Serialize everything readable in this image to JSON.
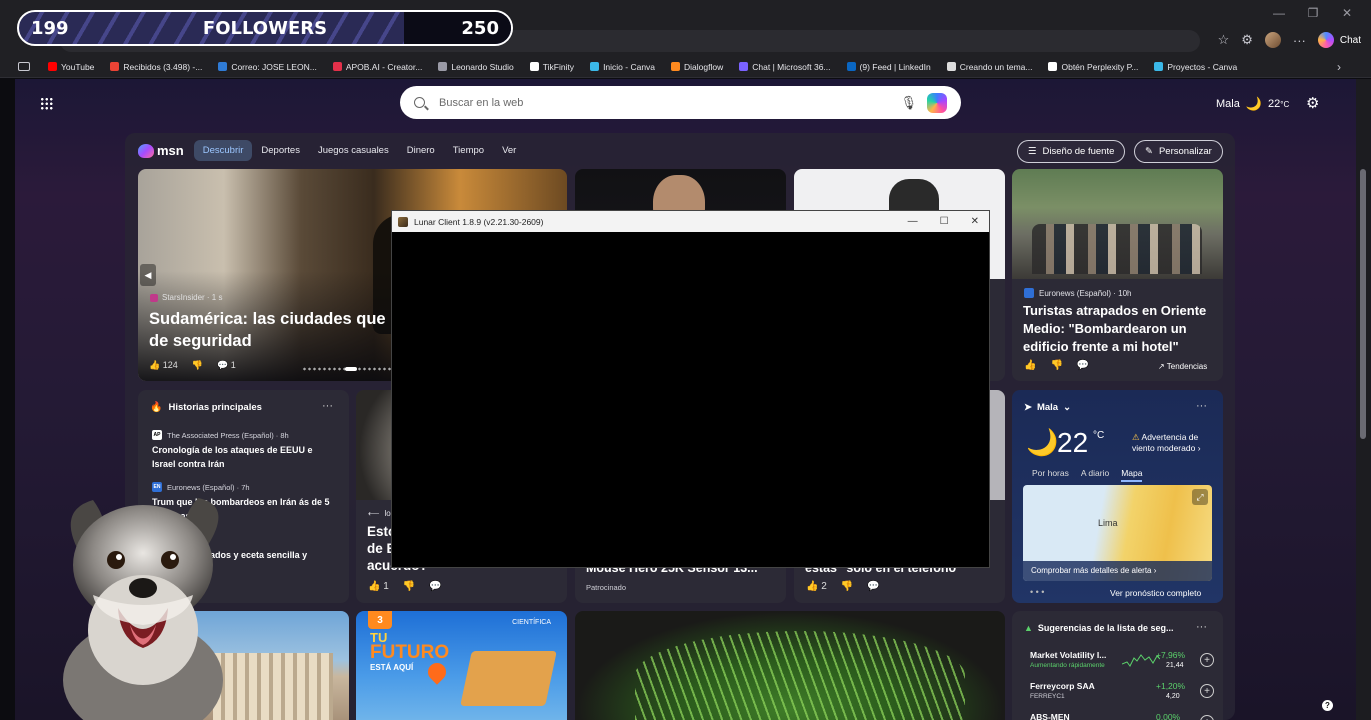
{
  "overlay": {
    "followers_current": "199",
    "followers_label": "FOLLOWERS",
    "followers_goal": "250",
    "progress_fraction": 0.796
  },
  "browser": {
    "actions": {
      "chat_label": "Chat"
    },
    "bookmarks": [
      {
        "label": "YouTube",
        "color": "#ff0000"
      },
      {
        "label": "Recibidos (3.498) -...",
        "color": "#ea4335"
      },
      {
        "label": "Correo: JOSE LEON...",
        "color": "#2f7bd6"
      },
      {
        "label": "APOB.AI - Creator...",
        "color": "#e3304a"
      },
      {
        "label": "Leonardo Studio",
        "color": "#9a9aa6"
      },
      {
        "label": "TikFinity",
        "color": "#ffffff"
      },
      {
        "label": "Inicio - Canva",
        "color": "#3bb8e8"
      },
      {
        "label": "Dialogflow",
        "color": "#ff8a1f"
      },
      {
        "label": "Chat | Microsoft 36...",
        "color": "#7a62ff"
      },
      {
        "label": "(9) Feed | LinkedIn",
        "color": "#0a66c2"
      },
      {
        "label": "Creando un tema...",
        "color": "#dddddd"
      },
      {
        "label": "Obtén Perplexity P...",
        "color": "#ffffff"
      },
      {
        "label": "Proyectos - Canva",
        "color": "#3bb8e8"
      }
    ]
  },
  "search": {
    "placeholder": "Buscar en la web"
  },
  "top_weather": {
    "location": "Mala",
    "temp": "22",
    "unit": "°C"
  },
  "msn": {
    "logo": "msn",
    "tabs": [
      "Descubrir",
      "Deportes",
      "Juegos casuales",
      "Dinero",
      "Tiempo",
      "Ver"
    ],
    "active_tab": "Descubrir",
    "font_design_button": "Diseño de fuente",
    "personalize_button": "Personalizar"
  },
  "hero": {
    "source": "StarsInsider · 1 s",
    "title": "Sudamérica: las ciudades que de seguridad",
    "likes": "124",
    "comments": "1"
  },
  "tourists": {
    "source": "Euronews (Español) · 10h",
    "title": "Turistas atrapados en Oriente Medio: \"Bombardearon un edificio frente a mi hotel\"",
    "trend": "Tendencias"
  },
  "historias": {
    "header": "Historias principales",
    "items": [
      {
        "source": "The Associated Press (Español) · 8h",
        "title": "Cronología de los ataques de EEUU e Israel contra Irán",
        "badge": "AP"
      },
      {
        "source": "Euronews (Español) · 7h",
        "title": "Trum que los bombardeos en Irán ás de 5 semanas",
        "badge": "EN"
      },
      {
        "source": "",
        "title": "mares congelados y eceta sencilla y sabrosa",
        "badge": ""
      }
    ]
  },
  "chain_card": {
    "source": "lo",
    "title": "Esto de E acuerdo?",
    "likes": "1"
  },
  "mouse_card": {
    "title": "Mouse Hero 25K Sensor 13...",
    "sponsor": "Patrocinado"
  },
  "phone_card": {
    "title": "estas \"solo en el teléfono\"",
    "likes": "2"
  },
  "weather": {
    "location": "Mala",
    "temp": "22",
    "unit": "°C",
    "alert": "Advertencia de viento moderado",
    "tabs": [
      "Por horas",
      "A diario",
      "Mapa"
    ],
    "active_tab": "Mapa",
    "map_label": "Lima",
    "map_cta": "Comprobar más detalles de alerta",
    "forecast_link": "Ver pronóstico completo"
  },
  "cientifica": {
    "badge": "3",
    "line1": "TU",
    "line2": "FUTURO",
    "line3": "ESTÁ AQUÍ",
    "brand": "CIENTÍFICA"
  },
  "stocks": {
    "header": "Sugerencias de la lista de seg...",
    "items": [
      {
        "name": "Market Volatility I...",
        "sub": "Aumentando rápidamente",
        "change": "+7,96%",
        "price": "21,44",
        "sub_green": true
      },
      {
        "name": "Ferreycorp SAA",
        "sub": "FERREYC1",
        "change": "+1,20%",
        "price": "4,20",
        "sub_green": false
      },
      {
        "name": "ABS-MEN",
        "sub": "",
        "change": "0,00%",
        "price": "",
        "sub_green": false
      }
    ]
  },
  "lunar": {
    "title": "Lunar Client 1.8.9 (v2.21.30-2609)"
  }
}
